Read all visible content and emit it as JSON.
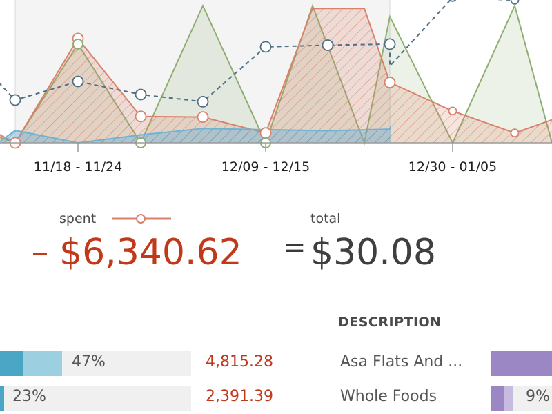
{
  "chart_data": {
    "type": "area",
    "x_labels": [
      "11/18 - 11/24",
      "12/09 - 12/15",
      "12/30 - 01/05"
    ],
    "series": [
      {
        "name": "spent",
        "values": [
          160,
          0,
          1900,
          480,
          470,
          180,
          2450,
          2450,
          1100,
          580,
          180,
          420
        ]
      },
      {
        "values": [
          110,
          0,
          1800,
          0,
          2500,
          0,
          2500,
          0,
          2300,
          0,
          2500,
          0
        ]
      },
      {
        "values": [
          1100,
          780,
          1120,
          880,
          750,
          1750,
          1780,
          1800,
          1400,
          2650,
          2600,
          2900
        ]
      },
      {
        "values": [
          25,
          225,
          0,
          145,
          260,
          240,
          220,
          250,
          300
        ]
      }
    ]
  },
  "colors": {
    "spent": "#d9826b",
    "spent_dark": "#c0391b",
    "green": "#8fae72",
    "dashed": "#4f6f84",
    "blue": "#6fb2d2",
    "purple": "#9b87c3"
  },
  "summary": {
    "spent_label": "spent",
    "total_label": "total",
    "spent_value": "$6,340.62",
    "equals": "=",
    "total_value": "$30.08"
  },
  "table": {
    "description_header": "DESCRIPTION",
    "rows": [
      {
        "pct": "47%",
        "pct_value": 0.47,
        "amount": "4,815.28",
        "description": "Asa Flats And ...",
        "right_pct": "",
        "right_fill": 1.0
      },
      {
        "pct": "23%",
        "pct_value": 0.23,
        "amount": "2,391.39",
        "description": "Whole Foods",
        "right_pct": "9%",
        "right_fill": 0.09
      }
    ]
  }
}
